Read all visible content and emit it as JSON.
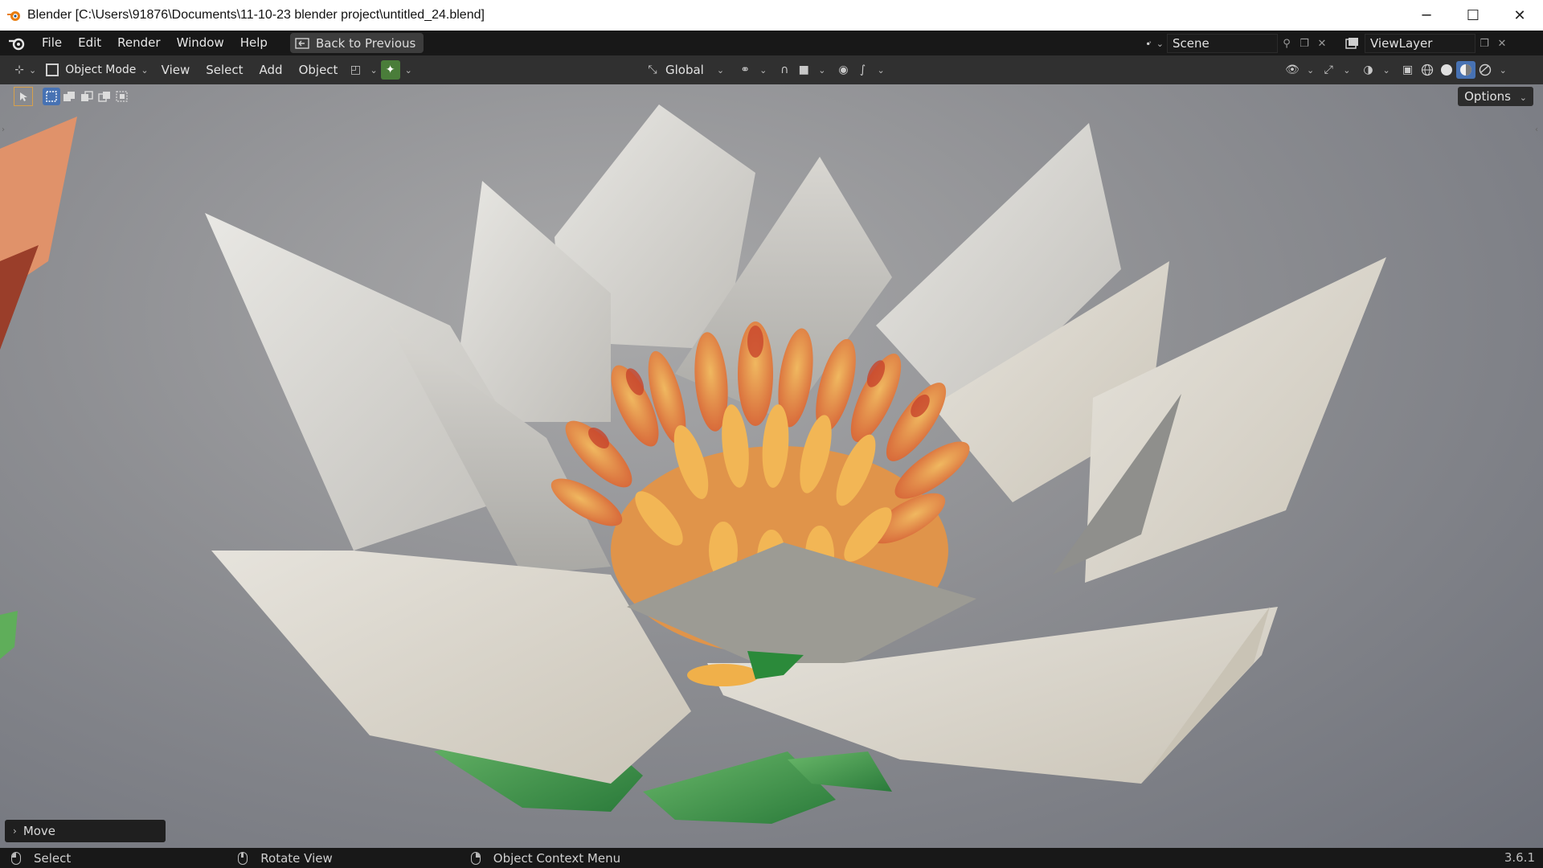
{
  "window": {
    "title": "Blender [C:\\Users\\91876\\Documents\\11-10-23 blender project\\untitled_24.blend]",
    "controls": [
      "─",
      "☐",
      "✕"
    ]
  },
  "menubar": {
    "items": [
      "File",
      "Edit",
      "Render",
      "Window",
      "Help"
    ],
    "back_button": "Back to Previous",
    "scene": "Scene",
    "view_layer": "ViewLayer"
  },
  "viewport_header": {
    "mode": "Object Mode",
    "menus": [
      "View",
      "Select",
      "Add",
      "Object"
    ],
    "transform_orientation": "Global",
    "options": "Options"
  },
  "operator_panel": {
    "label": "Move"
  },
  "statusbar": {
    "select": "Select",
    "rotate": "Rotate View",
    "context_menu": "Object Context Menu",
    "version": "3.6.1"
  },
  "colors": {
    "accent_blue": "#4772b3",
    "accent_green": "#4a7d3a",
    "tool_highlight": "#d7a04a"
  }
}
